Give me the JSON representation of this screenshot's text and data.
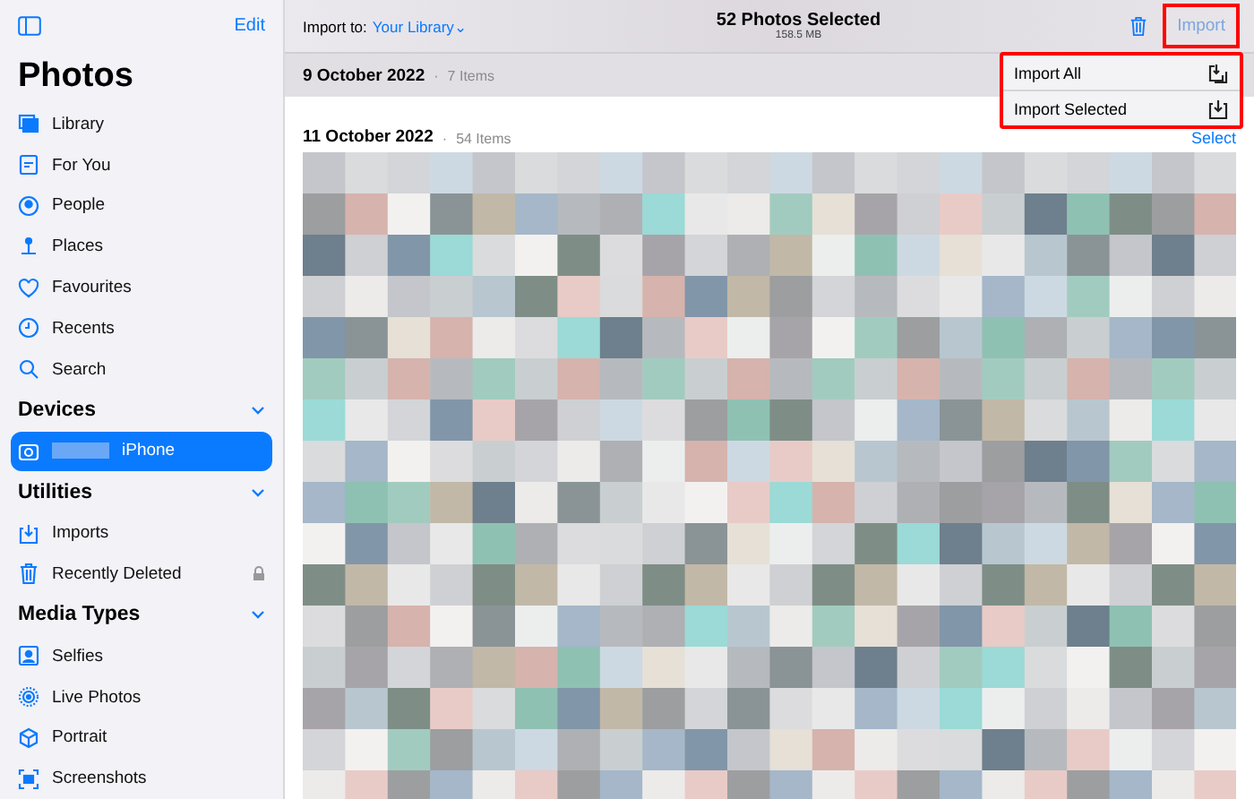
{
  "sidebar": {
    "edit": "Edit",
    "title": "Photos",
    "items": [
      {
        "label": "Library",
        "kind": "library",
        "selected": false,
        "locked": false
      },
      {
        "label": "For You",
        "kind": "foryou",
        "selected": false,
        "locked": false
      },
      {
        "label": "People",
        "kind": "people",
        "selected": false,
        "locked": false
      },
      {
        "label": "Places",
        "kind": "places",
        "selected": false,
        "locked": false
      },
      {
        "label": "Favourites",
        "kind": "heart",
        "selected": false,
        "locked": false
      },
      {
        "label": "Recents",
        "kind": "clock",
        "selected": false,
        "locked": false
      },
      {
        "label": "Search",
        "kind": "search",
        "selected": false,
        "locked": false
      }
    ],
    "sections": [
      {
        "title": "Devices",
        "expanded": true,
        "items": [
          {
            "label": "iPhone",
            "kind": "camera",
            "selected": true,
            "redacted": true,
            "locked": false
          }
        ]
      },
      {
        "title": "Utilities",
        "expanded": true,
        "items": [
          {
            "label": "Imports",
            "kind": "import",
            "selected": false,
            "locked": false
          },
          {
            "label": "Recently Deleted",
            "kind": "trash",
            "selected": false,
            "locked": true
          }
        ]
      },
      {
        "title": "Media Types",
        "expanded": true,
        "items": [
          {
            "label": "Selfies",
            "kind": "selfie",
            "selected": false,
            "locked": false
          },
          {
            "label": "Live Photos",
            "kind": "live",
            "selected": false,
            "locked": false
          },
          {
            "label": "Portrait",
            "kind": "cube",
            "selected": false,
            "locked": false
          },
          {
            "label": "Screenshots",
            "kind": "screenshot",
            "selected": false,
            "locked": false
          }
        ]
      }
    ]
  },
  "toolbar": {
    "import_to_label": "Import to:",
    "import_to_value": "Your Library",
    "import_to_caret": "⌄",
    "title": "52 Photos Selected",
    "subtitle": "158.5 MB",
    "import_button": {
      "label": "Import",
      "disabled": true,
      "highlighted": true
    }
  },
  "menu": {
    "highlighted": true,
    "items": [
      {
        "label": "Import All",
        "kind": "import-all"
      },
      {
        "label": "Import Selected",
        "kind": "import"
      }
    ]
  },
  "groups": [
    {
      "date": "9 October 2022",
      "separator": "·",
      "count": "7 Items"
    },
    {
      "date": "11 October 2022",
      "separator": "·",
      "count": "54 Items",
      "action": "Select"
    }
  ]
}
